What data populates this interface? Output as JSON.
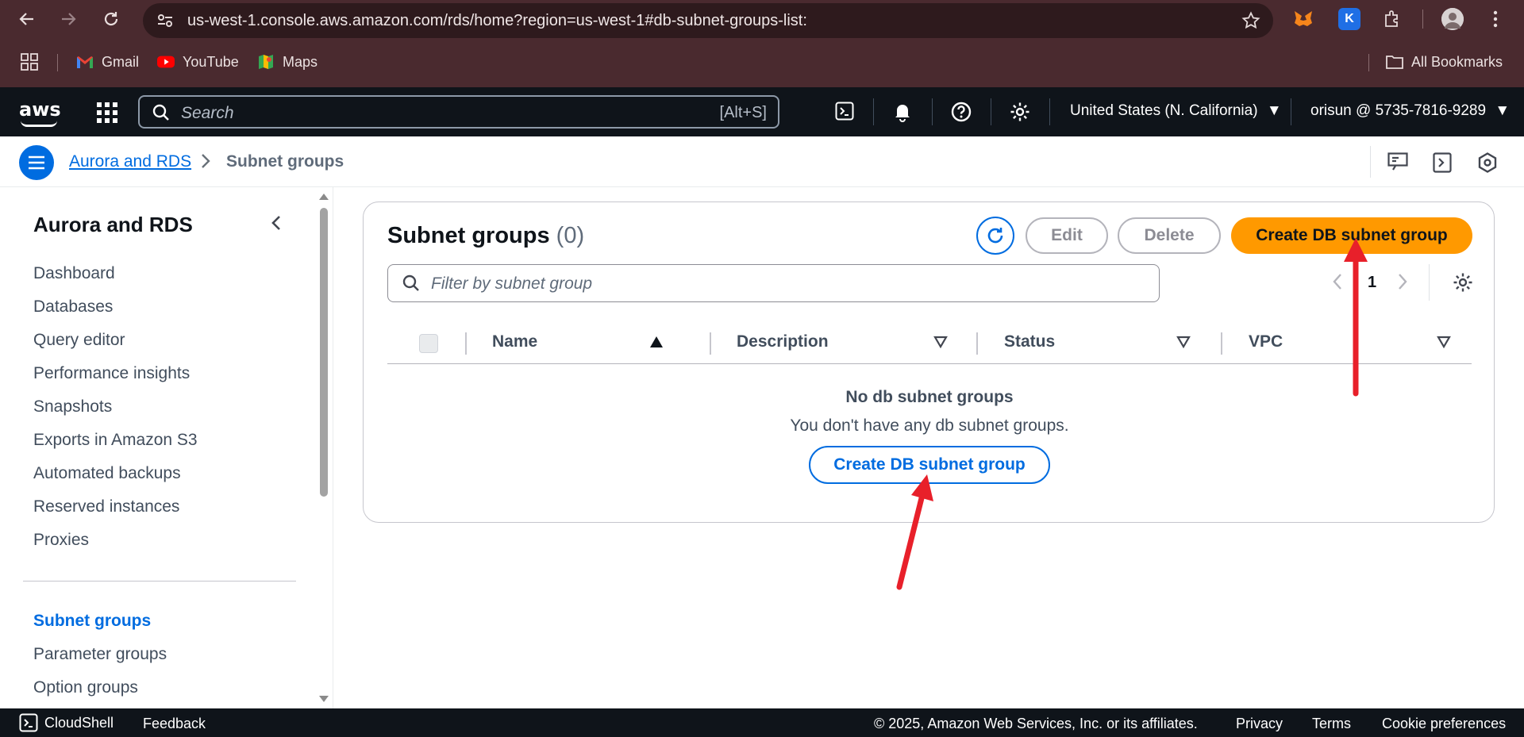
{
  "browser": {
    "url": "us-west-1.console.aws.amazon.com/rds/home?region=us-west-1#db-subnet-groups-list:",
    "bookmarks": [
      {
        "label": "Gmail",
        "icon": "gmail-icon"
      },
      {
        "label": "YouTube",
        "icon": "youtube-icon"
      },
      {
        "label": "Maps",
        "icon": "maps-icon"
      }
    ],
    "all_bookmarks_label": "All Bookmarks",
    "extension_k_label": "K"
  },
  "aws_nav": {
    "logo_text": "aws",
    "search_placeholder": "Search",
    "search_shortcut": "[Alt+S]",
    "region": "United States (N. California)",
    "account": "orisun @ 5735-7816-9289"
  },
  "breadcrumb": {
    "parent": "Aurora and RDS",
    "current": "Subnet groups"
  },
  "sidebar": {
    "title": "Aurora and RDS",
    "items": [
      {
        "label": "Dashboard",
        "active": false
      },
      {
        "label": "Databases",
        "active": false
      },
      {
        "label": "Query editor",
        "active": false
      },
      {
        "label": "Performance insights",
        "active": false
      },
      {
        "label": "Snapshots",
        "active": false
      },
      {
        "label": "Exports in Amazon S3",
        "active": false
      },
      {
        "label": "Automated backups",
        "active": false
      },
      {
        "label": "Reserved instances",
        "active": false
      },
      {
        "label": "Proxies",
        "active": false
      }
    ],
    "items2": [
      {
        "label": "Subnet groups",
        "active": true
      },
      {
        "label": "Parameter groups",
        "active": false
      },
      {
        "label": "Option groups",
        "active": false
      }
    ]
  },
  "panel": {
    "title": "Subnet groups",
    "count": "(0)",
    "edit_label": "Edit",
    "delete_label": "Delete",
    "create_label": "Create DB subnet group",
    "filter_placeholder": "Filter by subnet group",
    "page_number": "1",
    "columns": [
      "Name",
      "Description",
      "Status",
      "VPC"
    ],
    "empty_title": "No db subnet groups",
    "empty_subtitle": "You don't have any db subnet groups.",
    "empty_create_label": "Create DB subnet group"
  },
  "footer": {
    "cloudshell": "CloudShell",
    "feedback": "Feedback",
    "copyright": "© 2025, Amazon Web Services, Inc. or its affiliates.",
    "privacy": "Privacy",
    "terms": "Terms",
    "cookies": "Cookie preferences"
  },
  "colors": {
    "primary_orange": "#ff9900",
    "link_blue": "#006ce0",
    "nav_dark": "#0f141a",
    "annotation_red": "#e8202a"
  }
}
